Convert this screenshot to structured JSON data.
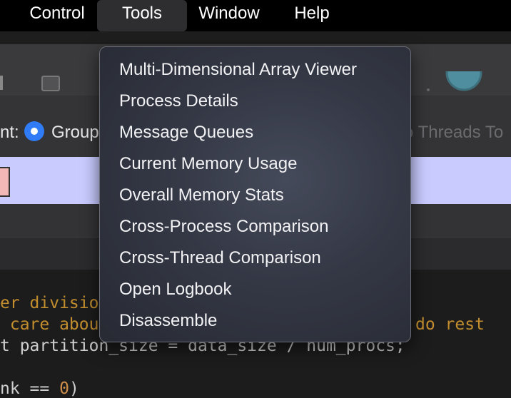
{
  "menubar": {
    "items": [
      {
        "label": "Control"
      },
      {
        "label": "Tools"
      },
      {
        "label": "Window"
      },
      {
        "label": "Help"
      }
    ]
  },
  "background": {
    "option_label": "nt:",
    "group_radio_label": "Group",
    "threads_label": "o Threads To",
    "code_lines": {
      "l1": "er divisio",
      "l2a": " care abou",
      "l2b": "do rest",
      "l3": "t partition_size = data_size / num_procs;",
      "l4_pre": "nk == ",
      "l4_num": "0",
      "l4_post": ")"
    }
  },
  "tools_menu": {
    "items": [
      {
        "label": "Multi-Dimensional Array Viewer"
      },
      {
        "label": "Process Details"
      },
      {
        "label": "Message Queues"
      },
      {
        "label": "Current Memory Usage"
      },
      {
        "label": "Overall Memory Stats"
      },
      {
        "label": "Cross-Process Comparison"
      },
      {
        "label": "Cross-Thread Comparison"
      },
      {
        "label": "Open Logbook"
      },
      {
        "label": "Disassemble"
      }
    ]
  },
  "colors": {
    "accent": "#2f7cf6",
    "highlight_row": "#c9cbff",
    "code_comment": "#c28e2e"
  }
}
